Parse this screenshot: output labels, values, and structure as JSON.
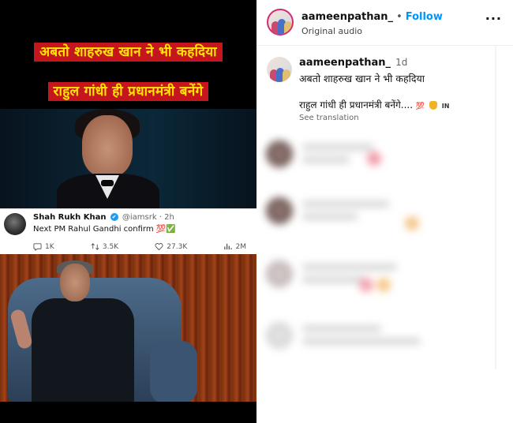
{
  "media": {
    "headline_1": "अबतो शाहरुख खान ने भी कहदिया",
    "headline_2": "राहुल गांधी ही प्रधानमंत्री बनेंगे",
    "tweet": {
      "name": "Shah Rukh Khan",
      "verified_mark": "✔",
      "handle": "@iamsrk · 2h",
      "text": "Next PM Rahul Gandhi confirm 💯✅",
      "replies": "1K",
      "retweets": "3.5K",
      "likes": "27.3K",
      "views": "2M"
    }
  },
  "post": {
    "username": "aameenpathan_",
    "dot": "•",
    "follow_label": "Follow",
    "audio_label": "Original audio",
    "more_label": "···"
  },
  "caption": {
    "username": "aameenpathan_",
    "time": "1d",
    "line1": "अबतो शाहरुख खान ने भी कहदिया",
    "line2": "राहुल गांधी ही प्रधानमंत्री बनेंगे....",
    "emoji_100": "💯",
    "flag_label": "IN",
    "see_translation": "See translation"
  },
  "colors": {
    "follow": "#0095f6",
    "headline_bg": "#c4161c",
    "headline_text": "#ffe600"
  },
  "icons": [
    "comment-icon",
    "retweet-icon",
    "heart-icon",
    "views-icon",
    "verified-icon",
    "more-icon"
  ]
}
